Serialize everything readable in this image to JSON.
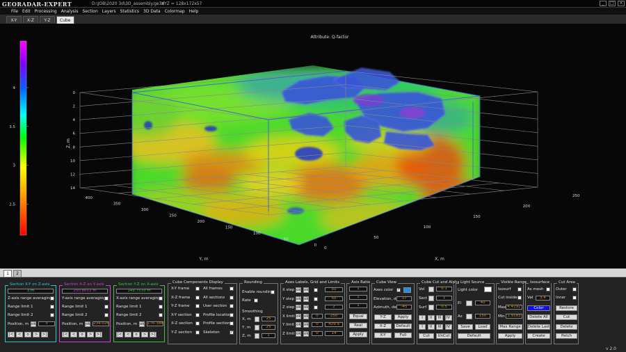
{
  "app": {
    "name": "GEORADAR-EXPERT",
    "file": "D:\\JOB\\2020 3d\\3D_assembly.ge3d",
    "dims": "XYZ = 128x172x57",
    "version": "v 2.0"
  },
  "menu": [
    "File",
    "Edit",
    "Processing",
    "Analysis",
    "Section",
    "Layers",
    "Statistics",
    "3D Data",
    "Colormap",
    "Help"
  ],
  "view_tabs": [
    {
      "label": "X-Y",
      "active": false
    },
    {
      "label": "X-Z",
      "active": false
    },
    {
      "label": "Y-Z",
      "active": false
    },
    {
      "label": "Cube",
      "active": true
    }
  ],
  "page_tabs": [
    {
      "label": "1",
      "active": true
    },
    {
      "label": "2",
      "active": false
    }
  ],
  "plot": {
    "title": "Attribute: Q-factor",
    "colorbar_ticks": [
      "4",
      "3.5",
      "3",
      "2.5"
    ],
    "colorbar_values": [
      4,
      3.5,
      3,
      2.5
    ],
    "colorbar_range": [
      2.1,
      4.6
    ],
    "z_label": "Z, m",
    "z_ticks": [
      "0",
      "2",
      "4",
      "6",
      "8",
      "10",
      "12",
      "14"
    ],
    "y_label": "Y, m",
    "y_ticks": [
      "400",
      "350",
      "300",
      "250",
      "200",
      "150",
      "100",
      "50",
      "0"
    ],
    "x_label": "X, m",
    "x_ticks": [
      "0",
      "50",
      "100",
      "150",
      "200",
      "250"
    ]
  },
  "panel": {
    "sec_xy": {
      "title": "Section X-Y on Z-axis",
      "value": "3 m",
      "range_avg": "Z-axis range averaging",
      "limit1": "Range limit 1",
      "limit2": "Range limit 2",
      "pos": "Position, m",
      "ok": "ok",
      "pos_val": "3",
      "color": "#2ec8c8"
    },
    "sec_xz": {
      "title": "Section X-Z on Y-axis",
      "value": "250.8652 m",
      "range_avg": "Y-axis range averaging",
      "limit1": "Range limit 1",
      "limit2": "Range limit 2",
      "pos": "Position, m",
      "ok": "ok",
      "pos_val": "234.026",
      "color": "#d040d0"
    },
    "sec_yz": {
      "title": "Section Y-Z on X-axis",
      "value": "149.7539 m",
      "range_avg": "X-axis range averaging",
      "limit1": "Range limit 1",
      "limit2": "Range limit 2",
      "pos": "Position, m",
      "ok": "ok",
      "pos_val": "176.388",
      "color": "#40c040"
    },
    "nav_buttons": [
      "|<",
      "<",
      "o",
      ">",
      ">|"
    ],
    "comp": {
      "title": "Cube Components Display",
      "left": [
        "X-Y frame",
        "X-Z frame",
        "Y-Z frame",
        "X-Y section",
        "X-Z section",
        "Y-Z section"
      ],
      "right": [
        "All frames",
        "All sections",
        "User section",
        "Profile location",
        "Profile section",
        "Skeleton"
      ],
      "right_checked": [
        false,
        false,
        false,
        false,
        false,
        true
      ]
    },
    "round": {
      "title": "Rounding",
      "enable": "Enable rounding",
      "rate": "Rate",
      "smooth": "Smoothing",
      "x": "X, m",
      "y": "Y, m",
      "z": "Z, m",
      "xv": "25",
      "yv": "25",
      "zv": "1"
    },
    "axes": {
      "title": "Axes Labels, Grid and Limits",
      "rows": [
        {
          "l": "X step",
          "v": "50"
        },
        {
          "l": "Y step",
          "v": "50"
        },
        {
          "l": "Z step",
          "v": "2"
        },
        {
          "l": "X limit",
          "v": "250"
        },
        {
          "l": "Y limit",
          "v": "429.9"
        },
        {
          "l": "Z limit",
          "v": "14"
        }
      ],
      "b1": "ok",
      "b2": "ok",
      "z1": "0",
      "z2": "0"
    },
    "ratio": {
      "title": "Axis Ratio",
      "v1": "1",
      "v2": "1",
      "v3": "1",
      "equal": "Equal",
      "real": "Real",
      "apply": "Apply"
    },
    "cview": {
      "title": "Cube View",
      "axes_color": "Axes color",
      "elev": "Elevation, deg",
      "elev_v": "37",
      "azim": "Azimuth, deg",
      "azim_v": "-45",
      "b": [
        "Y-Z",
        "Apply",
        "X-Z",
        "Default",
        "X-Y",
        "Full"
      ],
      "swatch": "#2a8ce0"
    },
    "cut": {
      "title": "Cube Cut and Alpha",
      "vol": "Vol",
      "sect": "Sect",
      "surf": "Surf",
      "vol_v": "0.1",
      "sect_v": "1",
      "surf_v": "0.5",
      "romans": [
        "I",
        "II",
        "III",
        "IV"
      ],
      "cut": "Cut",
      "uncut": "UnCut"
    },
    "light": {
      "title": "Light Source",
      "color": "Light color",
      "el": "El",
      "el_v": "40",
      "az": "Az",
      "az_v": "150",
      "save": "Save",
      "load": "Load",
      "def": "Default"
    },
    "vrange": {
      "title": "Visible Range",
      "isosurf": "Isosurf",
      "cutinside": "Cut inside",
      "max": "Max",
      "max_v": "4.4192",
      "min": "Min",
      "min_v": "1.9183",
      "maxrange": "Max Range",
      "apply": "Apply"
    },
    "iso": {
      "title": "Isosurface",
      "asmesh": "As mesh",
      "val": "Val",
      "val_v": "3.4",
      "color": "Color",
      "delall": "Delete All",
      "dellast": "Delete Last",
      "create": "Create"
    },
    "cutarea": {
      "title": "Cut Area",
      "outer": "Outer",
      "inner": "Inner",
      "restore": "Restore",
      "cut": "Cut",
      "delete": "Delete",
      "patch": "Patch"
    }
  }
}
